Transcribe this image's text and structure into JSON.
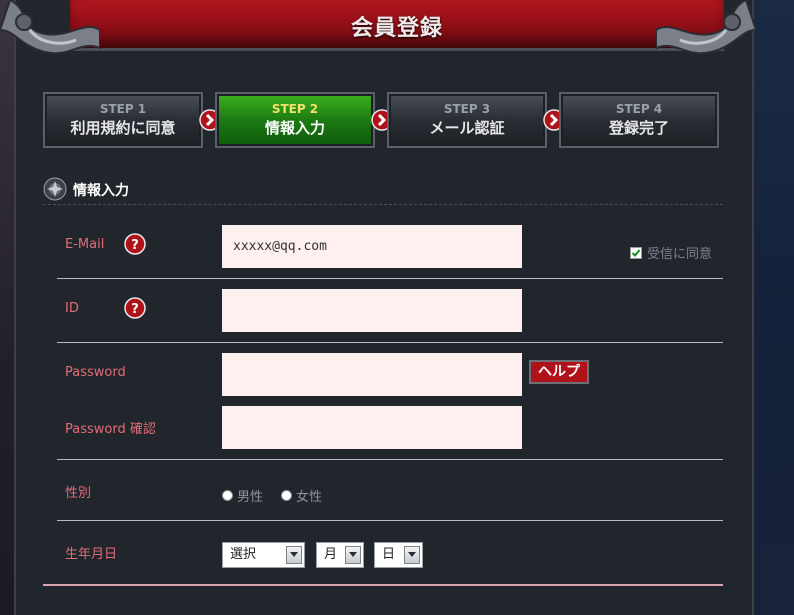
{
  "header": {
    "title": "会員登録"
  },
  "steps": [
    {
      "num": "STEP 1",
      "label": "利用規約に同意"
    },
    {
      "num": "STEP 2",
      "label": "情報入力"
    },
    {
      "num": "STEP 3",
      "label": "メール認証"
    },
    {
      "num": "STEP 4",
      "label": "登録完了"
    }
  ],
  "active_step": 2,
  "section": {
    "title": "情報入力"
  },
  "form": {
    "email": {
      "label": "E-Mail",
      "value": "xxxxx@qq.com",
      "consent_label": "受信に同意",
      "consent_checked": true
    },
    "id": {
      "label": "ID",
      "value": ""
    },
    "password": {
      "label": "Password",
      "value": "",
      "help_label": "ヘルプ"
    },
    "password_confirm": {
      "label": "Password 確認",
      "value": ""
    },
    "gender": {
      "label": "性別",
      "options": [
        "男性",
        "女性"
      ]
    },
    "birthday": {
      "label": "生年月日",
      "year": "選択",
      "month": "月",
      "day": "日"
    }
  },
  "colors": {
    "accent_red": "#b01219",
    "active_step_green": "#1c7a12",
    "label_red": "#e36c77",
    "field_bg": "#fff0f0"
  },
  "icons": {
    "help": "question-icon",
    "arrow": "chevron-right-icon",
    "section": "emblem-icon",
    "dropdown": "chevron-down-icon"
  }
}
